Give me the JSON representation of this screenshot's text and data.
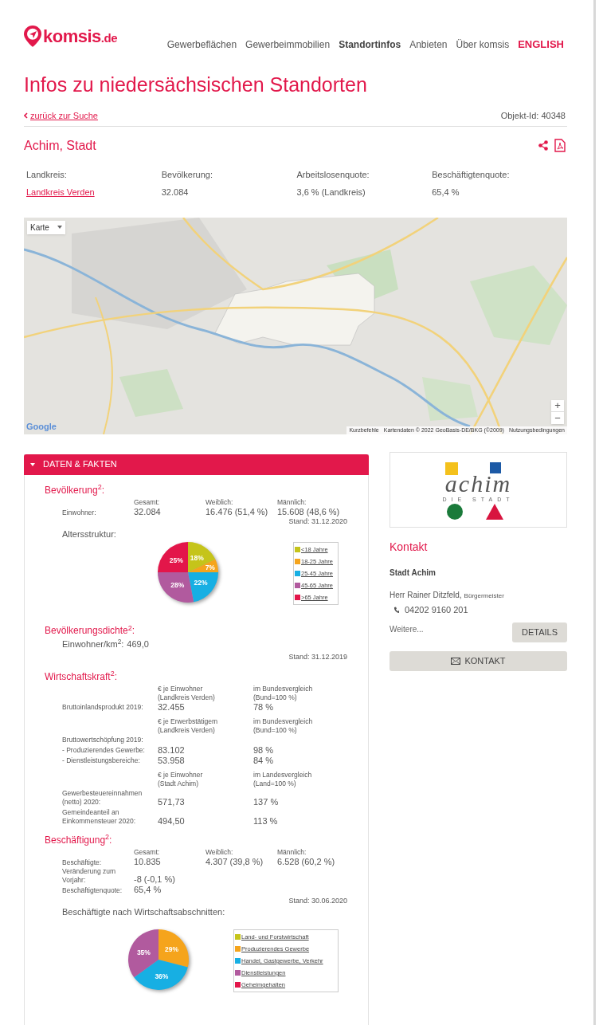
{
  "header": {
    "logo": {
      "name": "komsis",
      "tld": ".de"
    },
    "nav": [
      {
        "label": "Gewerbeflächen",
        "kind": "link",
        "selected": false
      },
      {
        "label": "Gewerbeimmobilien",
        "kind": "link",
        "selected": false
      },
      {
        "label": "Standortinfos",
        "kind": "link",
        "selected": true
      },
      {
        "label": "Anbieten",
        "kind": "link",
        "selected": false
      },
      {
        "label": "Über komsis",
        "kind": "link",
        "selected": false
      },
      {
        "label": "ENGLISH",
        "kind": "language",
        "selected": false
      }
    ]
  },
  "page_title": "Infos zu niedersächsischen Standorten",
  "back_link": "zurück zur Suche",
  "object_id": "Objekt-Id: 40348",
  "place_title": "Achim, Stadt",
  "facts": [
    {
      "label": "Landkreis:",
      "value": "Landkreis Verden",
      "kind": "link"
    },
    {
      "label": "Bevölkerung:",
      "value": "32.084",
      "kind": "text"
    },
    {
      "label": "Arbeitslosenquote:",
      "value": "3,6 % (Landkreis)",
      "kind": "text"
    },
    {
      "label": "Beschäftigtenquote:",
      "value": "65,4 %",
      "kind": "text"
    }
  ],
  "map": {
    "kind": "picture",
    "type_select": "Karte",
    "zoom_in": "+",
    "zoom_out": "−",
    "brand": "Google",
    "attribution": [
      "Kurzbefehle",
      "Kartendaten © 2022 GeoBasis-DE/BKG (©2009)",
      "Nutzungsbedingungen"
    ]
  },
  "panel": {
    "title": "DATEN & FAKTEN",
    "expanded": true,
    "population": {
      "title": "Bevölkerung$^{2}$:",
      "headers": [
        "Gesamt:",
        "Weiblich:",
        "Männlich:"
      ],
      "row_label": "Einwohner:",
      "values": [
        "32.084",
        "16.476 (51,4 %)",
        "15.608 (48,6 %)"
      ],
      "stand": "Stand: 31.12.2020",
      "chart_title": "Altersstruktur:",
      "chart_data": {
        "type": "pie",
        "categories": [
          "<18 Jahre",
          "18-25 Jahre",
          "25-45 Jahre",
          "45-65 Jahre",
          ">65 Jahre"
        ],
        "values": [
          18,
          7,
          22,
          28,
          25
        ],
        "colors": [
          "#c5c41a",
          "#f5a41c",
          "#17afe3",
          "#b15a9e",
          "#e3164a"
        ],
        "value_labels": [
          "18%",
          "7%",
          "22%",
          "28%",
          "25%"
        ],
        "legend": "right"
      }
    },
    "density": {
      "title": "Bevölkerungsdichte$^{2}$:",
      "label": "Einwohner/km$^{2}$:",
      "value": "469,0",
      "stand": "Stand: 31.12.2019"
    },
    "economy": {
      "title": "Wirtschaftskraft$^{2}$:",
      "groups": [
        {
          "header_value": [
            "€ je Einwohner",
            "(Landkreis Verden)"
          ],
          "header_compare": [
            "im Bundesvergleich",
            "(Bund=100 %)"
          ],
          "rows": [
            {
              "label": "Bruttoinlandsprodukt 2019:",
              "value": "32.455",
              "compare": "78 %"
            }
          ]
        },
        {
          "header_value": [
            "€ je Erwerbstätigem",
            "(Landkreis Verden)"
          ],
          "header_compare": [
            "im Bundesvergleich",
            "(Bund=100 %)"
          ],
          "rows": [
            {
              "label": "Bruttowertschöpfung 2019:"
            },
            {
              "label": "- Produzierendes Gewerbe:",
              "value": "83.102",
              "compare": "98 %"
            },
            {
              "label": "- Dienstleistungsbereiche:",
              "value": "53.958",
              "compare": "84 %"
            }
          ]
        },
        {
          "header_value": [
            "€ je Einwohner",
            "(Stadt Achim)"
          ],
          "header_compare": [
            "im Landesvergleich",
            "(Land=100 %)"
          ],
          "rows": [
            {
              "label": "Gewerbesteuereinnahmen (netto) 2020:",
              "value": "571,73",
              "compare": "137 %"
            },
            {
              "label": "Gemeindeanteil an Einkommensteuer 2020:",
              "value": "494,50",
              "compare": "113 %"
            }
          ]
        }
      ]
    },
    "employment": {
      "title": "Beschäftigung$^{2}$:",
      "headers": [
        "Gesamt:",
        "Weiblich:",
        "Männlich:"
      ],
      "rows": [
        {
          "label": "Beschäftigte:",
          "values": [
            "10.835",
            "4.307 (39,8 %)",
            "6.528 (60,2 %)"
          ]
        },
        {
          "label": "Veränderung zum Vorjahr:",
          "values": [
            "-8 (-0,1 %)"
          ]
        },
        {
          "label": "Beschäftigtenquote:",
          "values": [
            "65,4 %"
          ]
        }
      ],
      "stand": "Stand: 30.06.2020",
      "chart_title": "Beschäftigte nach Wirtschaftsabschnitten:",
      "chart_data": {
        "type": "pie",
        "categories": [
          "Land- und Forstwirtschaft",
          "Produzierendes Gewerbe",
          "Handel, Gastgewerbe, Verkehr",
          "Dienstleistungen",
          "Geheimgehalten"
        ],
        "values": [
          null,
          29,
          36,
          35,
          null
        ],
        "colors": [
          "#c5c41a",
          "#f5a41c",
          "#17afe3",
          "#b15a9e",
          "#e3164a"
        ],
        "value_labels": [
          null,
          "29%",
          "36%",
          "35%",
          null
        ],
        "legend": "right"
      }
    }
  },
  "contact": {
    "logo": {
      "wordmark": "achim",
      "tagline": "DIE STADT"
    },
    "title": "Kontakt",
    "org": "Stadt Achim",
    "person": "Herr Rainer Ditzfeld,",
    "role": "Bürgermeister",
    "phone": "04202 9160 201",
    "more": "Weitere...",
    "details_button": "DETAILS",
    "contact_button": "KONTAKT"
  }
}
